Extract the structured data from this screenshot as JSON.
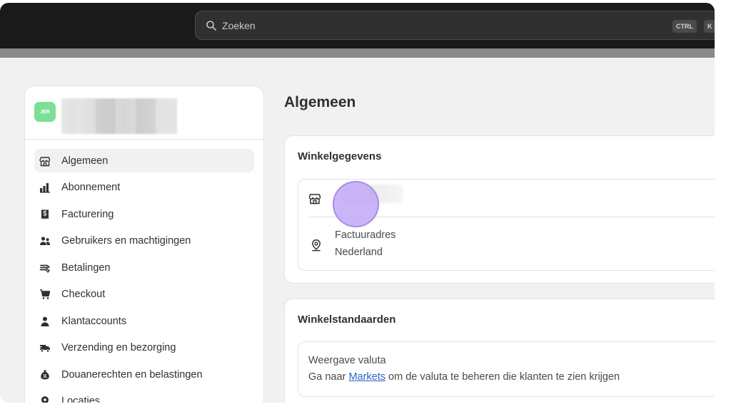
{
  "search": {
    "placeholder": "Zoeken",
    "kbd1": "CTRL",
    "kbd2": "K"
  },
  "store": {
    "avatar_initials": "JER"
  },
  "sidebar": {
    "items": [
      {
        "label": "Algemeen",
        "icon": "store-icon",
        "active": true
      },
      {
        "label": "Abonnement",
        "icon": "plan-icon"
      },
      {
        "label": "Facturering",
        "icon": "receipt-icon"
      },
      {
        "label": "Gebruikers en machtigingen",
        "icon": "users-icon"
      },
      {
        "label": "Betalingen",
        "icon": "payments-icon"
      },
      {
        "label": "Checkout",
        "icon": "cart-icon"
      },
      {
        "label": "Klantaccounts",
        "icon": "person-icon"
      },
      {
        "label": "Verzending en bezorging",
        "icon": "truck-icon"
      },
      {
        "label": "Douanerechten en belastingen",
        "icon": "tax-icon"
      },
      {
        "label": "Locaties",
        "icon": "location-icon"
      }
    ]
  },
  "main": {
    "title": "Algemeen",
    "store_details": {
      "title": "Winkelgegevens",
      "billing_label": "Factuuradres",
      "billing_country": "Nederland"
    },
    "store_defaults": {
      "title": "Winkelstandaarden",
      "currency_label": "Weergave valuta",
      "currency_text_before": "Ga naar",
      "currency_link": "Markets",
      "currency_text_after": "om de valuta te beheren die klanten te zien krijgen"
    }
  }
}
